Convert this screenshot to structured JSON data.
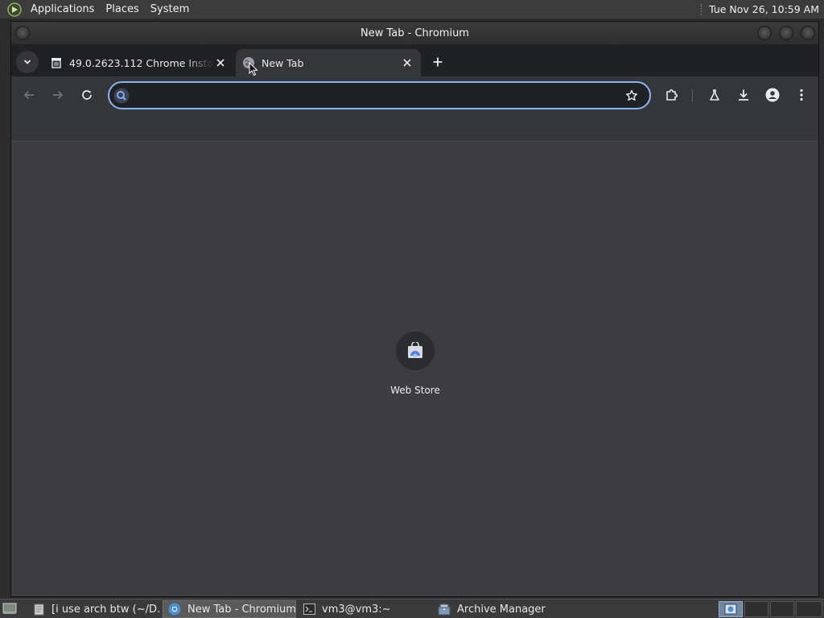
{
  "top_panel": {
    "menus": [
      "Applications",
      "Places",
      "System"
    ],
    "clock": "Tue Nov 26, 10:59 AM"
  },
  "window": {
    "title": "New Tab - Chromium"
  },
  "tabs": [
    {
      "title": "49.0.2623.112 Chrome Installer",
      "icon": "archive-icon",
      "active": false
    },
    {
      "title": "New Tab",
      "icon": "globe-icon",
      "active": true
    }
  ],
  "omnibox": {
    "value": "",
    "placeholder": ""
  },
  "shortcuts": [
    {
      "label": "Web Store",
      "icon": "web-store-icon"
    }
  ],
  "taskbar": {
    "tasks": [
      {
        "label": "[i use arch btw (~/D…",
        "icon": "text-editor-icon",
        "active": false
      },
      {
        "label": "New Tab - Chromium",
        "icon": "chromium-icon",
        "active": true
      },
      {
        "label": "vm3@vm3:~",
        "icon": "terminal-icon",
        "active": false
      },
      {
        "label": "Archive Manager",
        "icon": "archive-manager-icon",
        "active": false
      }
    ]
  },
  "colors": {
    "accent": "#8ab4f8",
    "content_bg": "#3c3c41",
    "toolbar_bg": "#35363a",
    "tabstrip_bg": "#202124"
  }
}
